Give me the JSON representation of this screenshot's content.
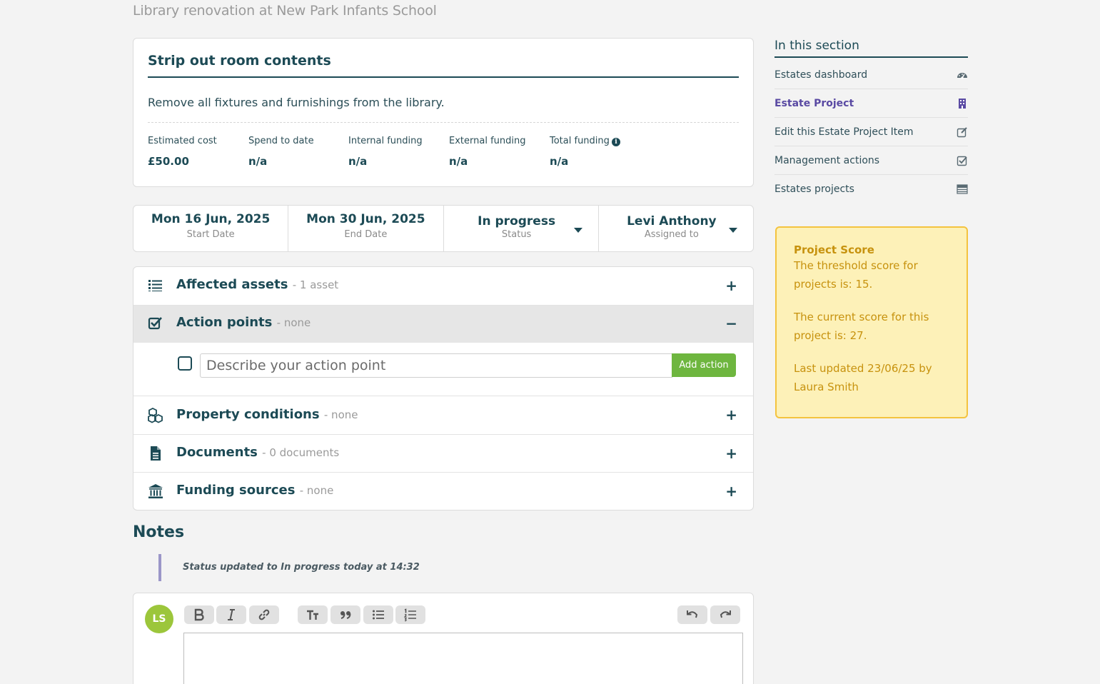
{
  "page": {
    "subtitle": "Library renovation at New Park Infants School"
  },
  "item": {
    "title": "Strip out room contents",
    "description": "Remove all fixtures and furnishings from the library.",
    "financials": [
      {
        "label": "Estimated cost",
        "value": "£50.00"
      },
      {
        "label": "Spend to date",
        "value": "n/a"
      },
      {
        "label": "Internal funding",
        "value": "n/a"
      },
      {
        "label": "External funding",
        "value": "n/a"
      },
      {
        "label": "Total funding",
        "value": "n/a"
      }
    ]
  },
  "meta": {
    "start_date": "Mon 16 Jun, 2025",
    "start_label": "Start Date",
    "end_date": "Mon 30 Jun, 2025",
    "end_label": "End Date",
    "status": "In progress",
    "status_label": "Status",
    "assignee": "Levi Anthony",
    "assignee_label": "Assigned to"
  },
  "sections": [
    {
      "title": "Affected assets",
      "count": "- 1 asset",
      "icon": "list-icon",
      "toggle": "+"
    },
    {
      "title": "Action points",
      "count": "- none",
      "icon": "check-square-icon",
      "toggle": "−"
    },
    {
      "title": "Property conditions",
      "count": "- none",
      "icon": "cubes-icon",
      "toggle": "+"
    },
    {
      "title": "Documents",
      "count": "- 0 documents",
      "icon": "file-icon",
      "toggle": "+"
    },
    {
      "title": "Funding sources",
      "count": "- none",
      "icon": "bank-icon",
      "toggle": "+"
    }
  ],
  "action_point": {
    "placeholder": "Describe your action point",
    "button": "Add action"
  },
  "notes": {
    "heading": "Notes",
    "entries": [
      "Status updated to In progress today at 14:32"
    ],
    "avatar_initials": "LS",
    "toolbar_icons": [
      "bold-icon",
      "italic-icon",
      "link-icon",
      "text-size-icon",
      "quote-icon",
      "bullet-list-icon",
      "numbered-list-icon",
      "undo-icon",
      "redo-icon"
    ]
  },
  "sidebar": {
    "heading": "In this section",
    "items": [
      {
        "label": "Estates dashboard",
        "icon": "dashboard-icon",
        "active": false
      },
      {
        "label": "Estate Project",
        "icon": "building-icon",
        "active": true
      },
      {
        "label": "Edit this Estate Project Item",
        "icon": "edit-icon",
        "active": false
      },
      {
        "label": "Management actions",
        "icon": "check-square-icon",
        "active": false
      },
      {
        "label": "Estates projects",
        "icon": "list-icon",
        "active": false
      }
    ]
  },
  "score": {
    "title": "Project Score",
    "threshold_text": "The threshold score for projects is: 15.",
    "current_text": "The current score for this project is: 27.",
    "updated_text": "Last updated 23/06/25 by Laura Smith"
  },
  "colors": {
    "primary": "#1c4a55",
    "accent_green": "#6eb63f",
    "active_link": "#5a4aa3",
    "score_bg": "#fdf1b8",
    "score_border": "#f4c33f",
    "score_text": "#c7920e"
  }
}
